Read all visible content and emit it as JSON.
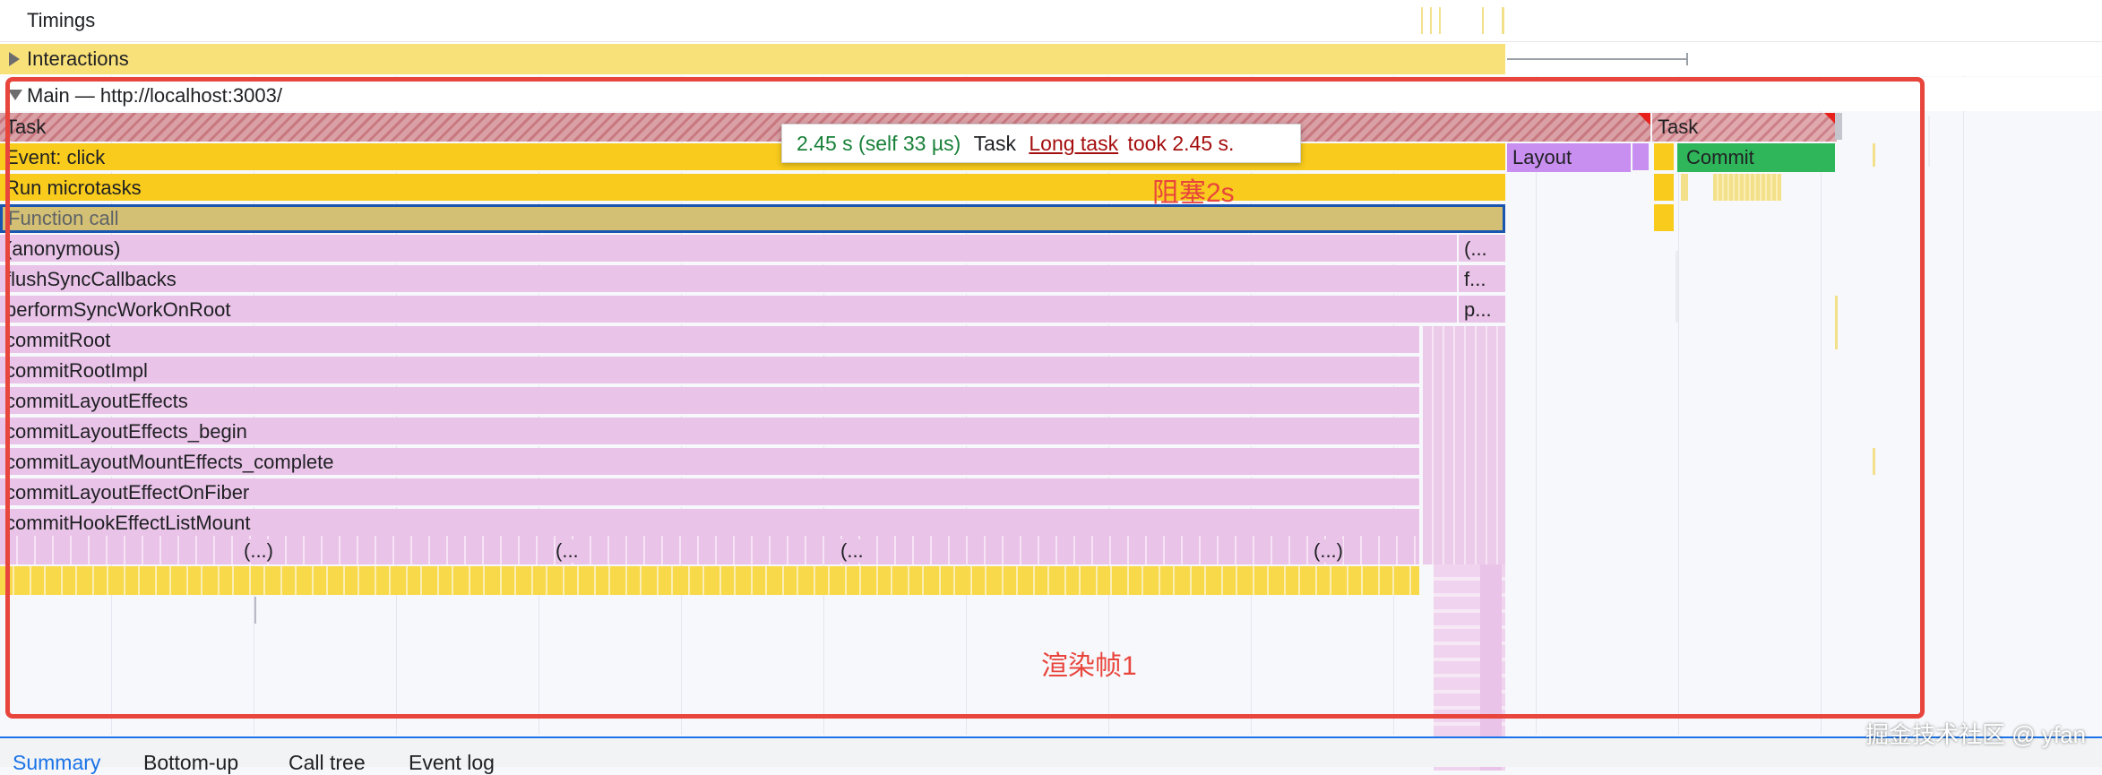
{
  "tracks": {
    "timings_label": "Timings",
    "interactions_label": "Interactions",
    "main_label": "Main — http://localhost:3003/"
  },
  "flame": {
    "task_left": "Task",
    "task_right": "Task",
    "event_click": "Event: click",
    "run_microtasks": "Run microtasks",
    "function_call": "Function call",
    "layout": "Layout",
    "commit": "Commit",
    "stack": [
      {
        "label": "(anonymous)",
        "tail": "(..."
      },
      {
        "label": "flushSyncCallbacks",
        "tail": "f..."
      },
      {
        "label": "performSyncWorkOnRoot",
        "tail": "p..."
      },
      {
        "label": "commitRoot",
        "tail": ""
      },
      {
        "label": "commitRootImpl",
        "tail": ""
      },
      {
        "label": "commitLayoutEffects",
        "tail": ""
      },
      {
        "label": "commitLayoutEffects_begin",
        "tail": ""
      },
      {
        "label": "commitLayoutMountEffects_complete",
        "tail": ""
      },
      {
        "label": "commitLayoutEffectOnFiber",
        "tail": ""
      },
      {
        "label": "commitHookEffectListMount",
        "tail": ""
      }
    ],
    "ellipsis_labels": [
      "(...)",
      "(...",
      "(...",
      "(...)"
    ]
  },
  "tooltip": {
    "duration": "2.45 s (self 33 µs)",
    "name": "Task",
    "link": "Long task",
    "suffix": "took 2.45 s."
  },
  "annotations": {
    "block_note": "阻塞2s",
    "frame_note": "渲染帧1",
    "watermark": "掘金技术社区 @ yfan",
    "annotation_color": "#e8453c"
  },
  "bottom_tabs": [
    "Summary",
    "Bottom-up",
    "Call tree",
    "Event log"
  ],
  "colors": {
    "script_yellow": "#f8cb1c",
    "js_pink": "#e9c3e8",
    "layout_purple": "#c88ef0",
    "commit_green": "#2fb65a",
    "selection_blue": "#1a55b0",
    "tooltip_green": "#188038",
    "link_red": "#a50e0e"
  }
}
